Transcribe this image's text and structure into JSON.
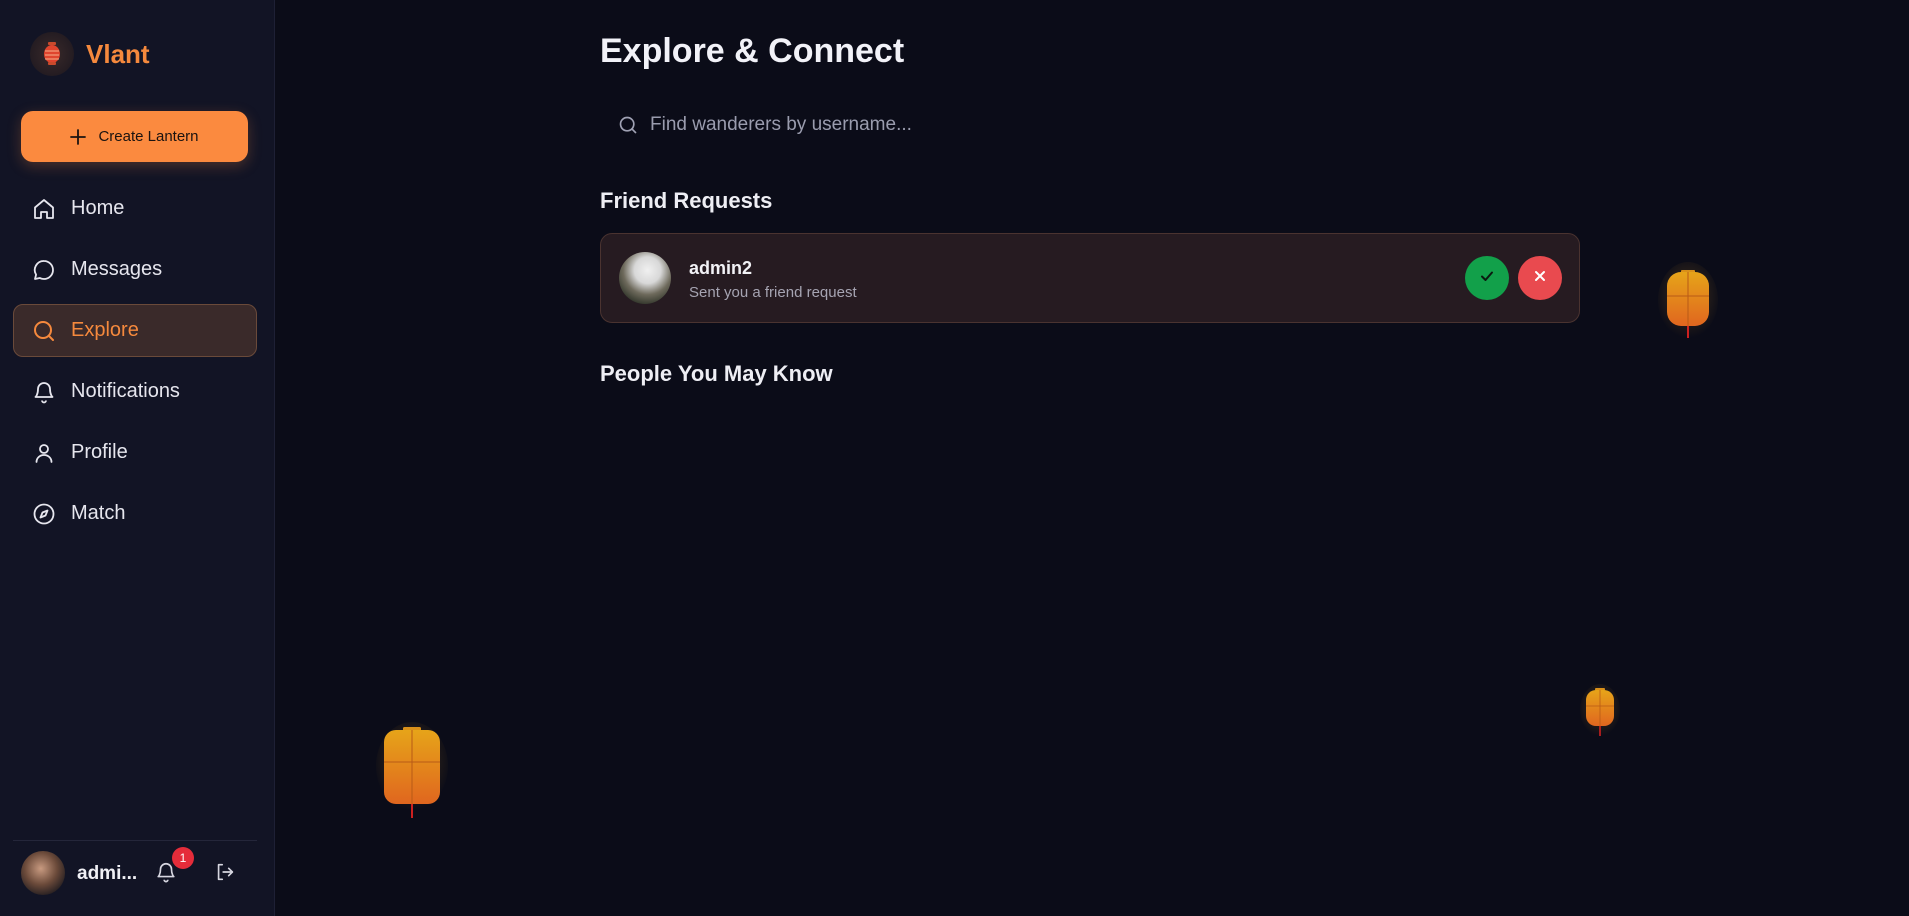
{
  "brand": {
    "name": "Vlant"
  },
  "sidebar": {
    "create_label": "Create Lantern",
    "items": [
      {
        "label": "Home",
        "icon": "home-icon"
      },
      {
        "label": "Messages",
        "icon": "message-icon"
      },
      {
        "label": "Explore",
        "icon": "search-icon",
        "active": true
      },
      {
        "label": "Notifications",
        "icon": "bell-icon"
      },
      {
        "label": "Profile",
        "icon": "user-icon"
      },
      {
        "label": "Match",
        "icon": "compass-icon"
      }
    ],
    "user": {
      "name": "admi...",
      "notification_count": "1"
    }
  },
  "main": {
    "title": "Explore & Connect",
    "search": {
      "placeholder": "Find wanderers by username...",
      "value": ""
    },
    "friend_requests": {
      "heading": "Friend Requests",
      "items": [
        {
          "name": "admin2",
          "subtitle": "Sent you a friend request"
        }
      ]
    },
    "people_heading": "People You May Know"
  },
  "colors": {
    "accent": "#fb8a3f",
    "background": "#0b0c18",
    "sidebar": "#121425",
    "accept": "#12a04a",
    "reject": "#e94a4f",
    "badge": "#e52c3a"
  }
}
